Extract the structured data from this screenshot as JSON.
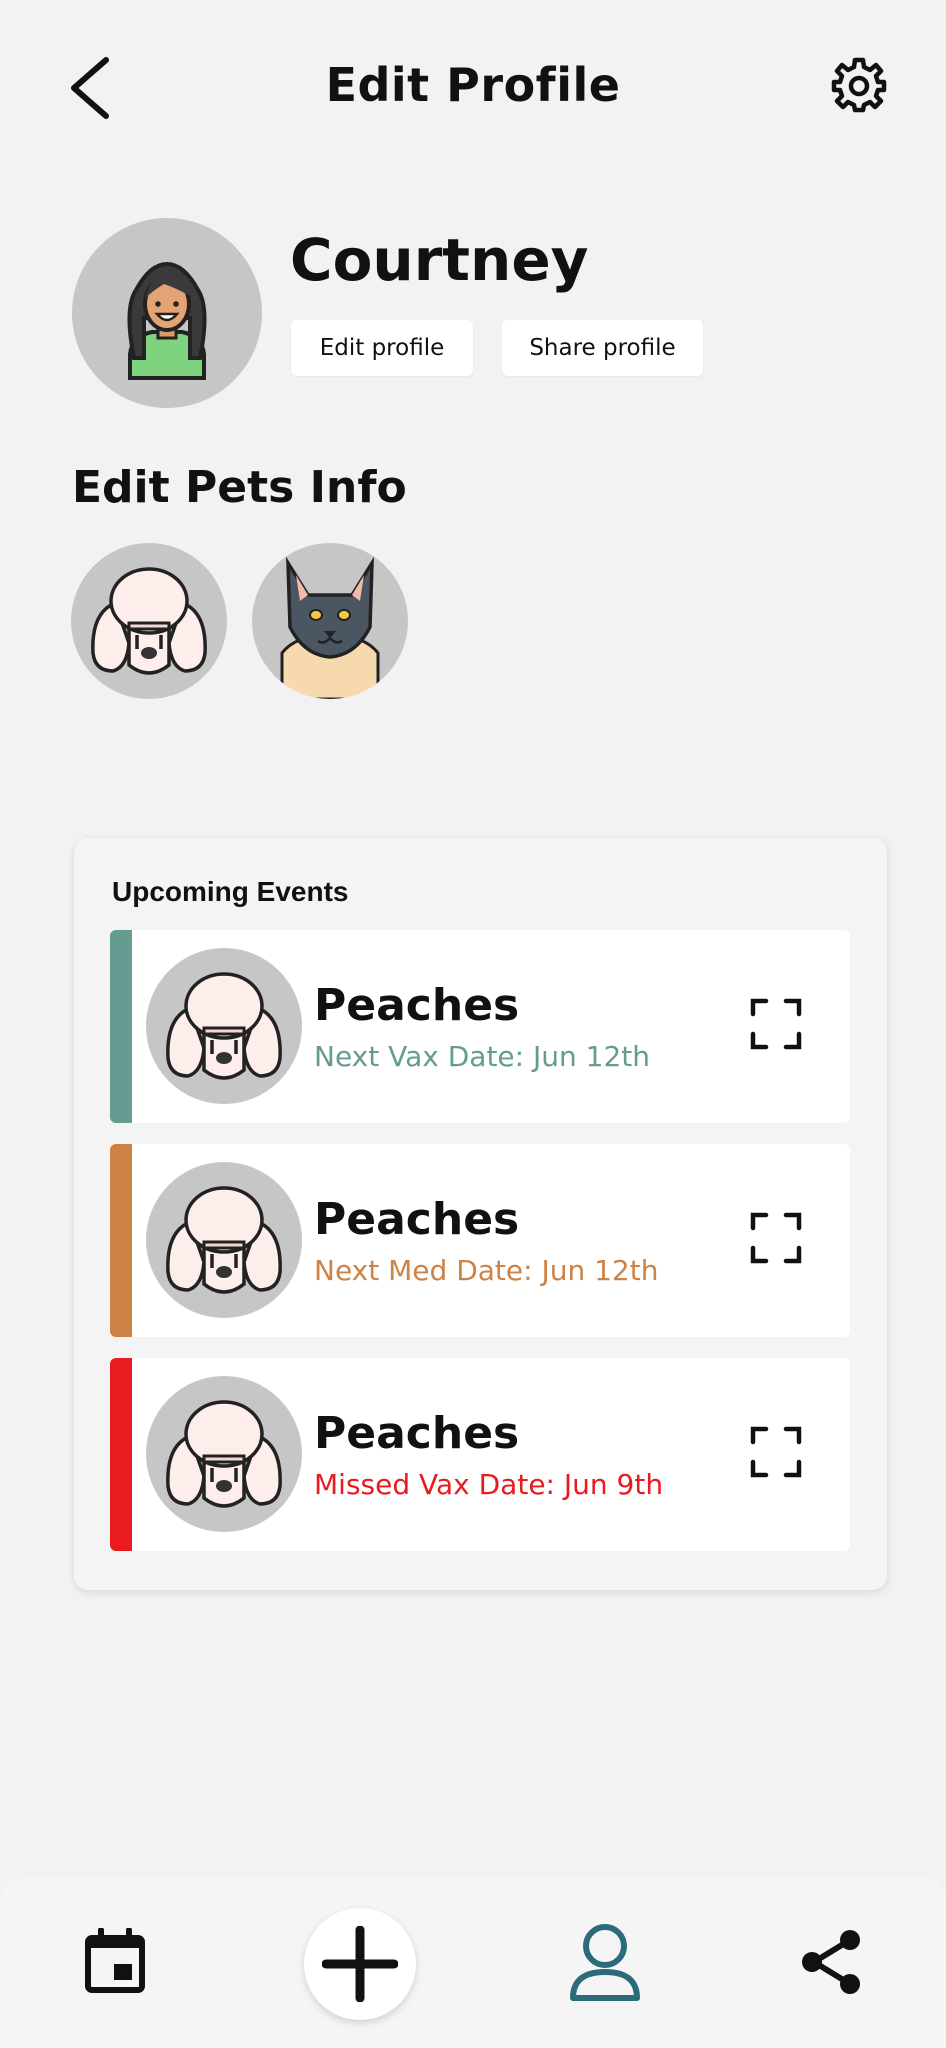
{
  "header": {
    "title": "Edit Profile",
    "back_icon": "chevron-left-icon",
    "settings_icon": "gear-icon"
  },
  "profile": {
    "name": "Courtney",
    "edit_label": "Edit profile",
    "share_label": "Share profile"
  },
  "pets_section": {
    "title": "Edit Pets Info",
    "pets": [
      {
        "icon": "poodle-avatar"
      },
      {
        "icon": "cat-avatar"
      }
    ]
  },
  "events": {
    "title": "Upcoming Events",
    "items": [
      {
        "name": "Peaches",
        "detail": "Next Vax Date: Jun 12th",
        "color": "#649c92"
      },
      {
        "name": "Peaches",
        "detail": "Next Med Date: Jun 12th",
        "color": "#cd8345"
      },
      {
        "name": "Peaches",
        "detail": "Missed Vax Date: Jun 9th",
        "color": "#e91b1e"
      }
    ]
  },
  "nav": {
    "items": [
      "calendar-icon",
      "plus-icon",
      "user-icon",
      "share-icon"
    ],
    "active_color": "#2c6b7a"
  }
}
